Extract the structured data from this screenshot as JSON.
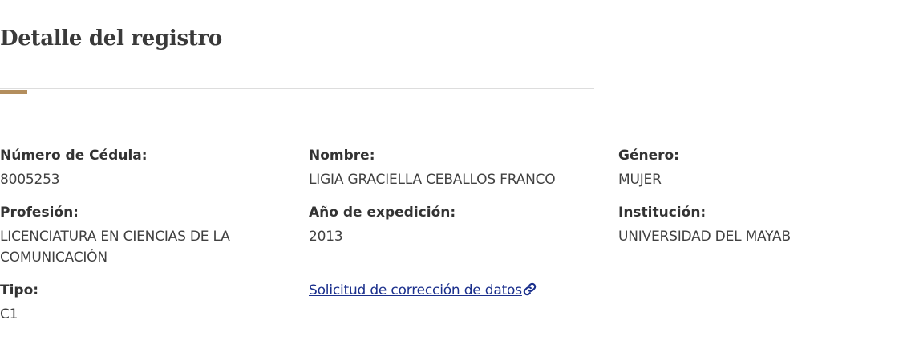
{
  "header": {
    "title": "Detalle del registro"
  },
  "colors": {
    "accent": "#b38e5d",
    "link": "#1a2f8c"
  },
  "fields": {
    "cedula": {
      "label": "Número de Cédula:",
      "value": "8005253"
    },
    "nombre": {
      "label": "Nombre:",
      "value": "LIGIA GRACIELLA CEBALLOS FRANCO"
    },
    "genero": {
      "label": "Género:",
      "value": "MUJER"
    },
    "profesion": {
      "label": "Profesión:",
      "value": "LICENCIATURA EN CIENCIAS DE LA COMUNICACIÓN"
    },
    "anio": {
      "label": "Año de expedición:",
      "value": "2013"
    },
    "institucion": {
      "label": "Institución:",
      "value": "UNIVERSIDAD DEL MAYAB"
    },
    "tipo": {
      "label": "Tipo:",
      "value": "C1"
    }
  },
  "correction_link": {
    "label": "Solicitud de corrección de datos",
    "icon": "link-icon"
  }
}
